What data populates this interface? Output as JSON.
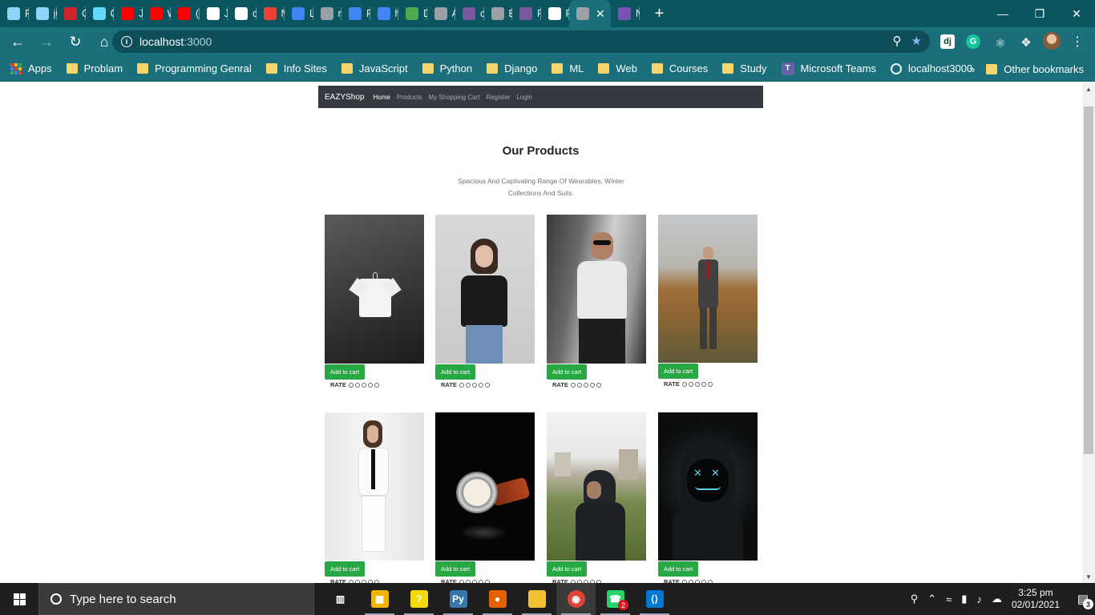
{
  "browser": {
    "tabs": [
      {
        "title": "Re",
        "icon": "webpack-icon",
        "color": "#8dd6f9"
      },
      {
        "title": "jQ",
        "icon": "webpack-icon",
        "color": "#8dd6f9"
      },
      {
        "title": "Cc",
        "icon": "codility-icon",
        "color": "#d2232a"
      },
      {
        "title": "O|",
        "icon": "react-icon",
        "color": "#61dafb"
      },
      {
        "title": "JS",
        "icon": "youtube-icon",
        "color": "#ff0000"
      },
      {
        "title": "W",
        "icon": "youtube-icon",
        "color": "#ff0000"
      },
      {
        "title": "(1)",
        "icon": "youtube-icon",
        "color": "#ff0000"
      },
      {
        "title": "Ja",
        "icon": "udemy-icon",
        "color": "#ffffff"
      },
      {
        "title": "co",
        "icon": "codechef-icon",
        "color": "#ffffff"
      },
      {
        "title": "Ne",
        "icon": "gmail-icon",
        "color": "#ea4335"
      },
      {
        "title": "La",
        "icon": "meet-icon",
        "color": "#4285f4"
      },
      {
        "title": "ra",
        "icon": "globe-icon",
        "color": "#9aa0a6"
      },
      {
        "title": "Fc",
        "icon": "google-icon",
        "color": "#4285f4"
      },
      {
        "title": "hc",
        "icon": "google-icon",
        "color": "#4285f4"
      },
      {
        "title": "D",
        "icon": "mongodb-icon",
        "color": "#4fa94d"
      },
      {
        "title": "Ap",
        "icon": "globe-icon",
        "color": "#9aa0a6"
      },
      {
        "title": "or",
        "icon": "heroku-icon",
        "color": "#79589f"
      },
      {
        "title": "Ex",
        "icon": "globe-icon",
        "color": "#9aa0a6"
      },
      {
        "title": "Pe",
        "icon": "heroku-icon",
        "color": "#79589f"
      },
      {
        "title": "Re",
        "icon": "github-icon",
        "color": "#ffffff"
      },
      {
        "title": "",
        "icon": "globe-icon",
        "color": "#9aa0a6",
        "active": true
      },
      {
        "title": "N:",
        "icon": "bootstrap-icon",
        "color": "#7952b3"
      }
    ],
    "new_tab": "+",
    "url_host": "localhost",
    "url_port": ":3000",
    "bookmarks": [
      {
        "label": "Apps",
        "icon": "apps-grid-icon"
      },
      {
        "label": "Problam",
        "icon": "folder-icon"
      },
      {
        "label": "Programming Genral",
        "icon": "folder-icon"
      },
      {
        "label": "Info Sites",
        "icon": "folder-icon"
      },
      {
        "label": "JavaScript",
        "icon": "folder-icon"
      },
      {
        "label": "Python",
        "icon": "folder-icon"
      },
      {
        "label": "Django",
        "icon": "folder-icon"
      },
      {
        "label": "ML",
        "icon": "folder-icon"
      },
      {
        "label": "Web",
        "icon": "folder-icon"
      },
      {
        "label": "Courses",
        "icon": "folder-icon"
      },
      {
        "label": "Study",
        "icon": "folder-icon"
      },
      {
        "label": "Microsoft Teams",
        "icon": "teams-icon"
      },
      {
        "label": "localhost3000",
        "icon": "globe-icon"
      }
    ],
    "bookmarks_more": "»",
    "other_bookmarks": "Other bookmarks"
  },
  "site": {
    "brand": "EAZYShop",
    "nav": [
      {
        "label": "Home",
        "active": true
      },
      {
        "label": "Products",
        "active": false
      },
      {
        "label": "My Shopping Cart",
        "active": false
      },
      {
        "label": "Register",
        "active": false
      },
      {
        "label": "Login",
        "active": false
      }
    ],
    "heading": "Our Products",
    "subheading": "Spacious And Captivating Range Of Wearables, Winter Collections And Suits.",
    "add_to_cart_label": "Add to cart",
    "rate_label": "RATE",
    "rating_circles": 5,
    "products": [
      {
        "image": "white-tshirt-on-hanger"
      },
      {
        "image": "woman-black-tshirt-jeans"
      },
      {
        "image": "man-white-vneck-sunglasses"
      },
      {
        "image": "man-grey-suit-field"
      },
      {
        "image": "woman-white-suit"
      },
      {
        "image": "wristwatch-black-background"
      },
      {
        "image": "man-black-hoodie-outdoors"
      },
      {
        "image": "hooded-figure-neon-mask"
      }
    ]
  },
  "taskbar": {
    "search_placeholder": "Type here to search",
    "apps": [
      {
        "name": "task-view-icon"
      },
      {
        "name": "microsoft-store-icon"
      },
      {
        "name": "sticky-help-icon"
      },
      {
        "name": "python-icon"
      },
      {
        "name": "firefox-icon"
      },
      {
        "name": "file-explorer-icon"
      },
      {
        "name": "chrome-icon"
      },
      {
        "name": "whatsapp-icon",
        "badge": "2"
      },
      {
        "name": "vscode-icon"
      }
    ],
    "time": "3:25 pm",
    "date": "02/01/2021",
    "notification_count": "3"
  }
}
